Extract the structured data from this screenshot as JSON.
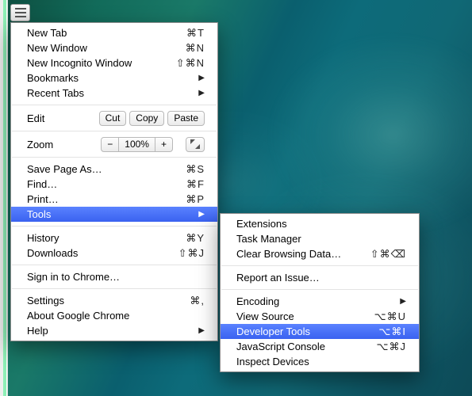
{
  "main_menu": {
    "new_tab": {
      "label": "New Tab",
      "accel": "⌘T"
    },
    "new_window": {
      "label": "New Window",
      "accel": "⌘N"
    },
    "new_incognito": {
      "label": "New Incognito Window",
      "accel": "⇧⌘N"
    },
    "bookmarks": {
      "label": "Bookmarks"
    },
    "recent_tabs": {
      "label": "Recent Tabs"
    },
    "edit": {
      "label": "Edit",
      "cut": "Cut",
      "copy": "Copy",
      "paste": "Paste"
    },
    "zoom": {
      "label": "Zoom",
      "current": "100%",
      "minus": "−",
      "plus": "+"
    },
    "save_page": {
      "label": "Save Page As…",
      "accel": "⌘S"
    },
    "find": {
      "label": "Find…",
      "accel": "⌘F"
    },
    "print": {
      "label": "Print…",
      "accel": "⌘P"
    },
    "tools": {
      "label": "Tools"
    },
    "history": {
      "label": "History",
      "accel": "⌘Y"
    },
    "downloads": {
      "label": "Downloads",
      "accel": "⇧⌘J"
    },
    "sign_in": {
      "label": "Sign in to Chrome…"
    },
    "settings": {
      "label": "Settings",
      "accel": "⌘,"
    },
    "about": {
      "label": "About Google Chrome"
    },
    "help": {
      "label": "Help"
    }
  },
  "tools_submenu": {
    "extensions": {
      "label": "Extensions"
    },
    "task_manager": {
      "label": "Task Manager"
    },
    "clear_data": {
      "label": "Clear Browsing Data…",
      "accel": "⇧⌘⌫"
    },
    "report_issue": {
      "label": "Report an Issue…"
    },
    "encoding": {
      "label": "Encoding"
    },
    "view_source": {
      "label": "View Source",
      "accel": "⌥⌘U"
    },
    "dev_tools": {
      "label": "Developer Tools",
      "accel": "⌥⌘I"
    },
    "js_console": {
      "label": "JavaScript Console",
      "accel": "⌥⌘J"
    },
    "inspect_devices": {
      "label": "Inspect Devices"
    }
  }
}
